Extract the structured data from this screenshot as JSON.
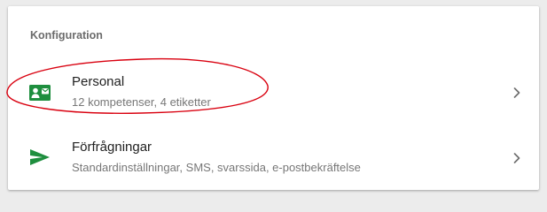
{
  "section": {
    "title": "Konfiguration"
  },
  "items": [
    {
      "title": "Personal",
      "subtitle": "12 kompetenser, 4 etiketter",
      "icon": "contact-card-icon"
    },
    {
      "title": "Förfrågningar",
      "subtitle": "Standardinställningar, SMS, svarssida, e-postbekräftelse",
      "icon": "send-icon"
    }
  ],
  "colors": {
    "accent_green": "#1e8e3e",
    "annotation_red": "#d9000f",
    "background": "#ececec",
    "card": "#ffffff"
  }
}
